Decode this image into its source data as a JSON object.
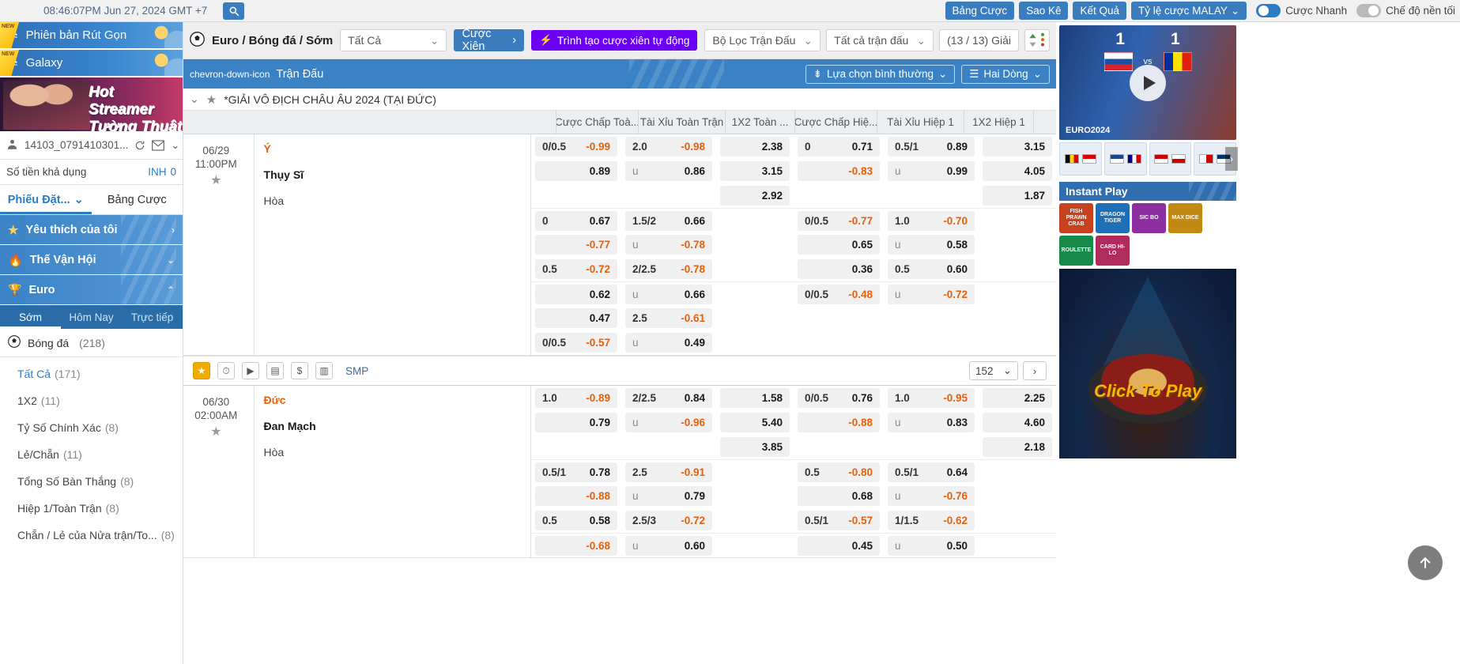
{
  "topbar": {
    "clock": "08:46:07PM Jun 27, 2024 GMT +7",
    "search_icon": "search-icon",
    "buttons": [
      {
        "label": "Bảng Cược"
      },
      {
        "label": "Sao Kê"
      },
      {
        "label": "Kết Quả"
      },
      {
        "label": "Tỷ lệ cược MALAY",
        "caret": "⌄"
      }
    ],
    "toggles": [
      {
        "label": "Cược Nhanh",
        "state": "on"
      },
      {
        "label": "Chế độ nền tối",
        "state": "off"
      }
    ]
  },
  "sidebar": {
    "promos": [
      {
        "label": "Phiên bản Rút Gọn",
        "badge": "NEW",
        "icon": "swap-icon"
      },
      {
        "label": "Galaxy",
        "badge": "NEW",
        "icon": "swap-icon"
      }
    ],
    "banner": {
      "line1": "Hot Streamer",
      "line2": "Tường Thuật"
    },
    "user": {
      "id": "14103_0791410301...",
      "refresh_icon": "refresh-icon",
      "mail_icon": "mail-icon",
      "caret": "⌄"
    },
    "balance": {
      "label": "Số tiền khả dụng",
      "currency": "INH",
      "amount": "0"
    },
    "tabs": [
      {
        "label": "Phiếu Đặt...",
        "active": true,
        "caret": "⌄"
      },
      {
        "label": "Bảng Cược",
        "active": false
      }
    ],
    "nav": [
      {
        "label": "Yêu thích của tôi",
        "icon": "star-icon",
        "chev": "›"
      },
      {
        "label": "Thế Vận Hội",
        "icon": "torch-icon",
        "chev": "⌄"
      },
      {
        "label": "Euro",
        "icon": "trophy-icon",
        "chev": "⌃"
      }
    ],
    "subtabs": [
      {
        "label": "Sớm",
        "active": true
      },
      {
        "label": "Hôm Nay",
        "active": false
      },
      {
        "label": "Trực tiếp",
        "active": false
      }
    ],
    "sport": {
      "label": "Bóng đá",
      "count": "(218)",
      "icon": "football-icon"
    },
    "markets": [
      {
        "label": "Tất Cả",
        "count": "(171)",
        "active": true
      },
      {
        "label": "1X2",
        "count": "(11)",
        "active": false
      },
      {
        "label": "Tỷ Số Chính Xác",
        "count": "(8)",
        "active": false
      },
      {
        "label": "Lẻ/Chẵn",
        "count": "(11)",
        "active": false
      },
      {
        "label": "Tổng Số Bàn Thắng",
        "count": "(8)",
        "active": false
      },
      {
        "label": "Hiệp 1/Toàn Trận",
        "count": "(8)",
        "active": false
      },
      {
        "label": "Chẵn / Lẻ của Nửa trận/To...",
        "count": "(8)",
        "active": false
      }
    ]
  },
  "center": {
    "breadcrumb": "Euro / Bóng đá / Sớm",
    "breadcrumb_icon": "football-icon",
    "filter_select": {
      "value": "Tất Cả",
      "caret": "⌄"
    },
    "parlay_button": {
      "label": "Cược Xiên",
      "chev": "›"
    },
    "auto_parlay_button": {
      "label": "Trình tạo cược xiên tự động",
      "icon": "lightning-icon"
    },
    "match_filter": {
      "value": "Bộ Lọc Trận Đấu",
      "caret": "⌄"
    },
    "all_matches": {
      "value": "Tất cả trận đấu",
      "caret": "⌄"
    },
    "league_count": "(13 / 13) Giải",
    "sort_icon": "sort-updown-icon",
    "bluebar": {
      "label": "Trận Đấu",
      "collapse_icon": "chevron-down-icon",
      "view_select": {
        "value": "Lựa chọn bình thường",
        "icon": "sort-icon",
        "caret": "⌄"
      },
      "rows_select": {
        "value": "Hai Dòng",
        "icon": "rows-icon",
        "caret": "⌄"
      }
    },
    "league": {
      "name": "*GIẢI VÔ ĐỊCH CHÂU ÂU 2024 (TẠI ĐỨC)",
      "star_icon": "star-icon",
      "chev": "⌄"
    },
    "columns": [
      "Cược Chấp Toà...",
      "Tài Xỉu Toàn Trận",
      "1X2 Toàn ...",
      "Cược Chấp Hiệ...",
      "Tài Xỉu Hiệp 1",
      "1X2 Hiệp 1"
    ],
    "matches": [
      {
        "date": "06/29",
        "time": "11:00PM",
        "home": "Ý",
        "away": "Thụy Sĩ",
        "draw": "Hòa",
        "lines": [
          [
            {
              "hdp": "0/0.5",
              "odd": "-0.99",
              "neg": true
            },
            {
              "hdp": "2.0",
              "odd": "-0.98",
              "neg": true
            },
            {
              "hdp": "",
              "odd": "2.38",
              "neg": false
            },
            {
              "hdp": "0",
              "odd": "0.71",
              "neg": false
            },
            {
              "hdp": "0.5/1",
              "odd": "0.89",
              "neg": false
            },
            {
              "hdp": "",
              "odd": "3.15",
              "neg": false
            }
          ],
          [
            {
              "hdp": "",
              "odd": "0.89",
              "neg": false
            },
            {
              "hdp": "u",
              "odd": "0.86",
              "neg": false
            },
            {
              "hdp": "",
              "odd": "3.15",
              "neg": false
            },
            {
              "hdp": "",
              "odd": "-0.83",
              "neg": true
            },
            {
              "hdp": "u",
              "odd": "0.99",
              "neg": false
            },
            {
              "hdp": "",
              "odd": "4.05",
              "neg": false
            }
          ],
          [
            {
              "hdp": "",
              "odd": "",
              "neg": false
            },
            {
              "hdp": "",
              "odd": "",
              "neg": false
            },
            {
              "hdp": "",
              "odd": "2.92",
              "neg": false
            },
            {
              "hdp": "",
              "odd": "",
              "neg": false
            },
            {
              "hdp": "",
              "odd": "",
              "neg": false
            },
            {
              "hdp": "",
              "odd": "1.87",
              "neg": false
            }
          ],
          [
            {
              "hdp": "0",
              "odd": "0.67",
              "neg": false
            },
            {
              "hdp": "1.5/2",
              "odd": "0.66",
              "neg": false
            },
            {
              "hdp": "",
              "odd": "",
              "neg": false
            },
            {
              "hdp": "0/0.5",
              "odd": "-0.77",
              "neg": true
            },
            {
              "hdp": "1.0",
              "odd": "-0.70",
              "neg": true
            },
            {
              "hdp": "",
              "odd": "",
              "neg": false
            }
          ],
          [
            {
              "hdp": "",
              "odd": "-0.77",
              "neg": true
            },
            {
              "hdp": "u",
              "odd": "-0.78",
              "neg": true
            },
            {
              "hdp": "",
              "odd": "",
              "neg": false
            },
            {
              "hdp": "",
              "odd": "0.65",
              "neg": false
            },
            {
              "hdp": "u",
              "odd": "0.58",
              "neg": false
            },
            {
              "hdp": "",
              "odd": "",
              "neg": false
            }
          ],
          [
            {
              "hdp": "0.5",
              "odd": "-0.72",
              "neg": true
            },
            {
              "hdp": "2/2.5",
              "odd": "-0.78",
              "neg": true
            },
            {
              "hdp": "",
              "odd": "",
              "neg": false
            },
            {
              "hdp": "",
              "odd": "0.36",
              "neg": false
            },
            {
              "hdp": "0.5",
              "odd": "0.60",
              "neg": false
            },
            {
              "hdp": "",
              "odd": "",
              "neg": false
            }
          ],
          [
            {
              "hdp": "",
              "odd": "0.62",
              "neg": false
            },
            {
              "hdp": "u",
              "odd": "0.66",
              "neg": false
            },
            {
              "hdp": "",
              "odd": "",
              "neg": false
            },
            {
              "hdp": "0/0.5",
              "odd": "-0.48",
              "neg": true
            },
            {
              "hdp": "u",
              "odd": "-0.72",
              "neg": true
            },
            {
              "hdp": "",
              "odd": "",
              "neg": false
            }
          ],
          [
            {
              "hdp": "",
              "odd": "0.47",
              "neg": false
            },
            {
              "hdp": "2.5",
              "odd": "-0.61",
              "neg": true
            },
            {
              "hdp": "",
              "odd": "",
              "neg": false
            },
            {
              "hdp": "",
              "odd": "",
              "neg": false
            },
            {
              "hdp": "",
              "odd": "",
              "neg": false
            },
            {
              "hdp": "",
              "odd": "",
              "neg": false
            }
          ],
          [
            {
              "hdp": "0/0.5",
              "odd": "-0.57",
              "neg": true
            },
            {
              "hdp": "u",
              "odd": "0.49",
              "neg": false
            },
            {
              "hdp": "",
              "odd": "",
              "neg": false
            },
            {
              "hdp": "",
              "odd": "",
              "neg": false
            },
            {
              "hdp": "",
              "odd": "",
              "neg": false
            },
            {
              "hdp": "",
              "odd": "",
              "neg": false
            }
          ]
        ]
      },
      {
        "date": "06/30",
        "time": "02:00AM",
        "home": "Đức",
        "away": "Đan Mạch",
        "draw": "Hòa",
        "lines": [
          [
            {
              "hdp": "1.0",
              "odd": "-0.89",
              "neg": true
            },
            {
              "hdp": "2/2.5",
              "odd": "0.84",
              "neg": false
            },
            {
              "hdp": "",
              "odd": "1.58",
              "neg": false
            },
            {
              "hdp": "0/0.5",
              "odd": "0.76",
              "neg": false
            },
            {
              "hdp": "1.0",
              "odd": "-0.95",
              "neg": true
            },
            {
              "hdp": "",
              "odd": "2.25",
              "neg": false
            }
          ],
          [
            {
              "hdp": "",
              "odd": "0.79",
              "neg": false
            },
            {
              "hdp": "u",
              "odd": "-0.96",
              "neg": true
            },
            {
              "hdp": "",
              "odd": "5.40",
              "neg": false
            },
            {
              "hdp": "",
              "odd": "-0.88",
              "neg": true
            },
            {
              "hdp": "u",
              "odd": "0.83",
              "neg": false
            },
            {
              "hdp": "",
              "odd": "4.60",
              "neg": false
            }
          ],
          [
            {
              "hdp": "",
              "odd": "",
              "neg": false
            },
            {
              "hdp": "",
              "odd": "",
              "neg": false
            },
            {
              "hdp": "",
              "odd": "3.85",
              "neg": false
            },
            {
              "hdp": "",
              "odd": "",
              "neg": false
            },
            {
              "hdp": "",
              "odd": "",
              "neg": false
            },
            {
              "hdp": "",
              "odd": "2.18",
              "neg": false
            }
          ],
          [
            {
              "hdp": "0.5/1",
              "odd": "0.78",
              "neg": false
            },
            {
              "hdp": "2.5",
              "odd": "-0.91",
              "neg": true
            },
            {
              "hdp": "",
              "odd": "",
              "neg": false
            },
            {
              "hdp": "0.5",
              "odd": "-0.80",
              "neg": true
            },
            {
              "hdp": "0.5/1",
              "odd": "0.64",
              "neg": false
            },
            {
              "hdp": "",
              "odd": "",
              "neg": false
            }
          ],
          [
            {
              "hdp": "",
              "odd": "-0.88",
              "neg": true
            },
            {
              "hdp": "u",
              "odd": "0.79",
              "neg": false
            },
            {
              "hdp": "",
              "odd": "",
              "neg": false
            },
            {
              "hdp": "",
              "odd": "0.68",
              "neg": false
            },
            {
              "hdp": "u",
              "odd": "-0.76",
              "neg": true
            },
            {
              "hdp": "",
              "odd": "",
              "neg": false
            }
          ],
          [
            {
              "hdp": "0.5",
              "odd": "0.58",
              "neg": false
            },
            {
              "hdp": "2.5/3",
              "odd": "-0.72",
              "neg": true
            },
            {
              "hdp": "",
              "odd": "",
              "neg": false
            },
            {
              "hdp": "0.5/1",
              "odd": "-0.57",
              "neg": true
            },
            {
              "hdp": "1/1.5",
              "odd": "-0.62",
              "neg": true
            },
            {
              "hdp": "",
              "odd": "",
              "neg": false
            }
          ],
          [
            {
              "hdp": "",
              "odd": "-0.68",
              "neg": true
            },
            {
              "hdp": "u",
              "odd": "0.60",
              "neg": false
            },
            {
              "hdp": "",
              "odd": "",
              "neg": false
            },
            {
              "hdp": "",
              "odd": "0.45",
              "neg": false
            },
            {
              "hdp": "u",
              "odd": "0.50",
              "neg": false
            },
            {
              "hdp": "",
              "odd": "",
              "neg": false
            }
          ]
        ]
      }
    ],
    "actionbar": {
      "icons": [
        "star-icon",
        "stopwatch-icon",
        "play-icon",
        "scoreboard-icon",
        "dollar-icon",
        "stats-icon"
      ],
      "smp_label": "SMP",
      "page_value": "152",
      "page_caret": "⌄",
      "next_label": "›"
    }
  },
  "right": {
    "video": {
      "home_score": "1",
      "away_score": "1",
      "vs": "vs",
      "euro_label": "EURO2024",
      "play_icon": "play-icon",
      "home_flag": "slovakia-flag",
      "away_flag": "romania-flag"
    },
    "thumbs": [
      {
        "name": "match-thumb-1"
      },
      {
        "name": "match-thumb-2"
      },
      {
        "name": "match-thumb-3"
      },
      {
        "name": "match-thumb-4"
      }
    ],
    "instant_play": {
      "title": "Instant Play"
    },
    "games": [
      {
        "label": "FISH PRAWN CRAB",
        "color": "#c8411f"
      },
      {
        "label": "DRAGON TIGER",
        "color": "#1d6fb8"
      },
      {
        "label": "SIC BO",
        "color": "#8d2fa0"
      },
      {
        "label": "MAX DICE",
        "color": "#c28a12"
      },
      {
        "label": "ROULETTE",
        "color": "#188a4a"
      },
      {
        "label": "CARD HI-LO",
        "color": "#b02c5d"
      }
    ],
    "casino": {
      "cta": "Click To Play"
    },
    "to_top_icon": "arrow-up-icon"
  }
}
